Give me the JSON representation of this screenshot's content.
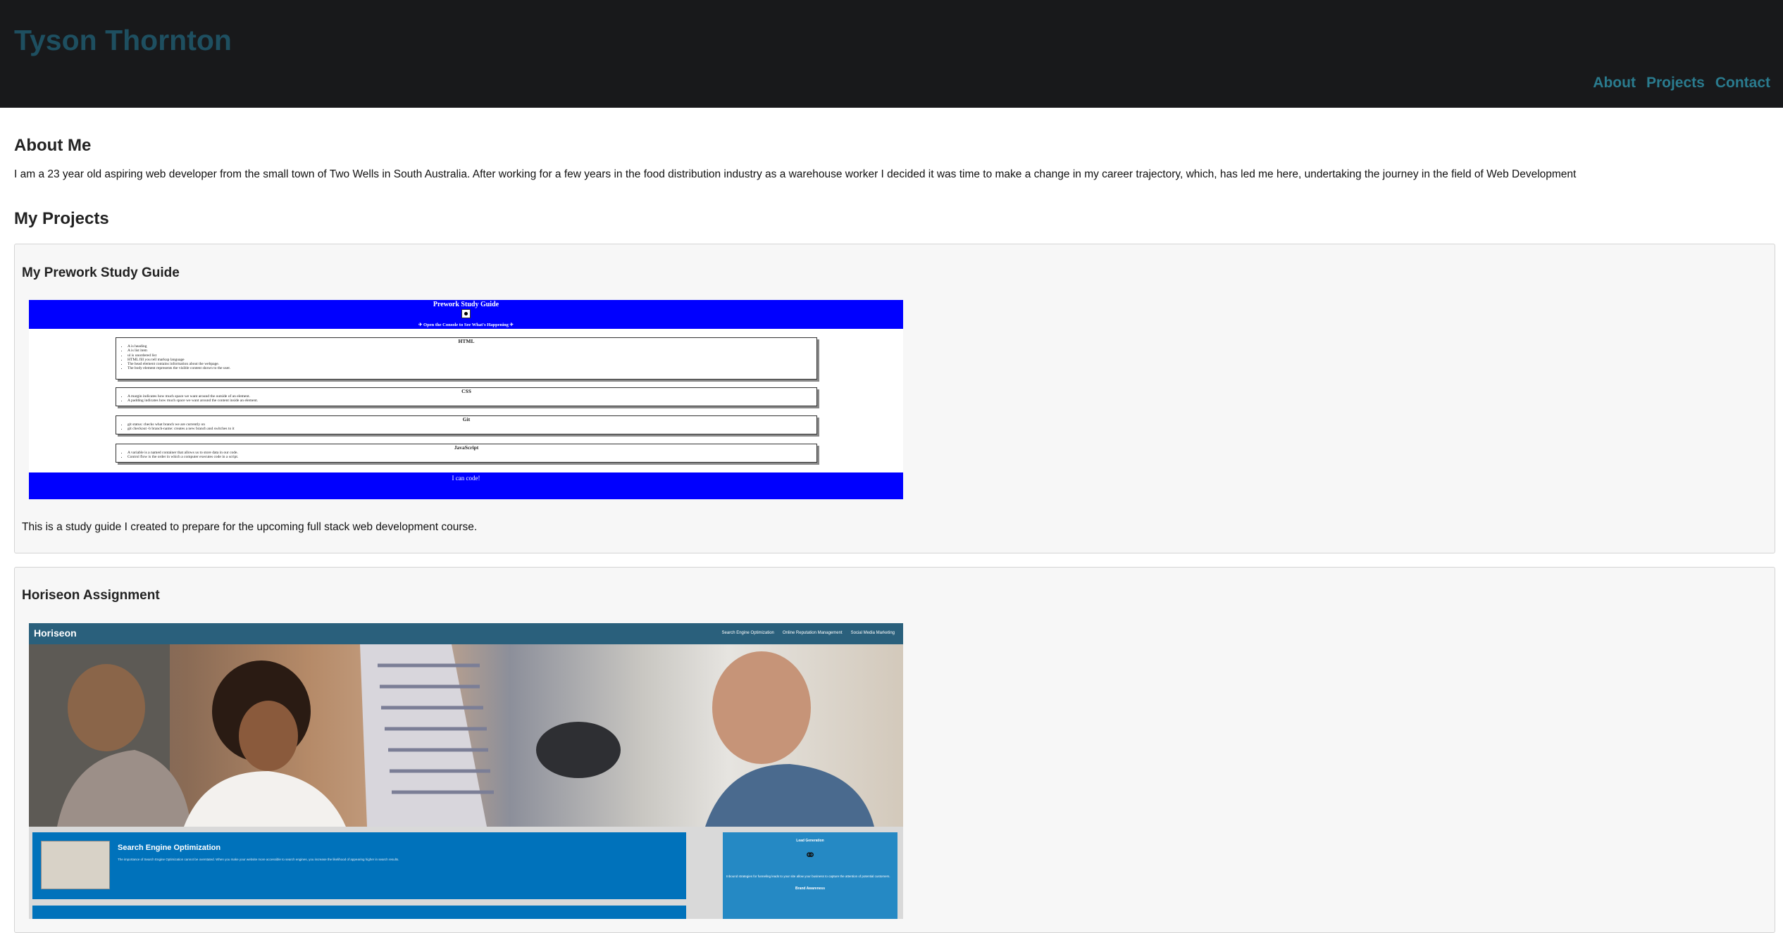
{
  "header": {
    "name": "Tyson Thornton",
    "nav": [
      "About",
      "Projects",
      "Contact"
    ]
  },
  "about": {
    "heading": "About Me",
    "text": "I am a 23 year old aspiring web developer from the small town of Two Wells in South Australia. After working for a few years in the food distribution industry as a warehouse worker I decided it was time to make a change in my career trajectory, which, has led me here, undertaking the journey in the field of Web Development"
  },
  "projects": {
    "heading": "My Projects",
    "items": [
      {
        "title": "My Prework Study Guide",
        "description": "This is a study guide I created to prepare for the upcoming full stack web development course.",
        "thumbnail": {
          "title": "Prework Study Guide",
          "subtitle": "✈ Open the Console to See What's Happening ✈",
          "sections": [
            {
              "title": "HTML",
              "items": [
                "A is heading",
                "A is list item",
                "ul is unordered list",
                "HTML fill you tell markup language",
                "The head element contains information about the webpage.",
                "The body element represents the visible content shown to the user."
              ]
            },
            {
              "title": "CSS",
              "items": [
                "A margin indicates how much space we want around the outside of an element.",
                "A padding indicates how much space we want around the content inside an element."
              ]
            },
            {
              "title": "Git",
              "items": [
                "git status: checks what branch we are currently on",
                "git checkout -b branch-name: creates a new branch and switches to it"
              ]
            },
            {
              "title": "JavaScript",
              "items": [
                "A variable is a named container that allows us to store data in our code.",
                "Control flow is the order in which a computer executes code in a script."
              ]
            }
          ],
          "footer": "I can code!"
        }
      },
      {
        "title": "Horiseon Assignment",
        "thumbnail": {
          "logo": "Horiseon",
          "links": [
            "Search Engine Optimization",
            "Online Reputation Management",
            "Social Media Marketing"
          ],
          "panel_title": "Search Engine Optimization",
          "panel_text": "The importance of Search Engine Optimization cannot be overstated. When you make your website more accessible to search engines, you increase the likelihood of appearing higher in search results.",
          "aside_title": "Lead Generation",
          "aside_text": "Inbound strategies for funneling leads to your site allow your business to capture the attention of potential customers.",
          "aside_title2": "Brand Awareness"
        }
      }
    ]
  },
  "colors": {
    "header_bg": "#18191b",
    "brand": "#1e4f60",
    "nav": "#2a7b8e",
    "card_bg": "#f7f7f7"
  }
}
